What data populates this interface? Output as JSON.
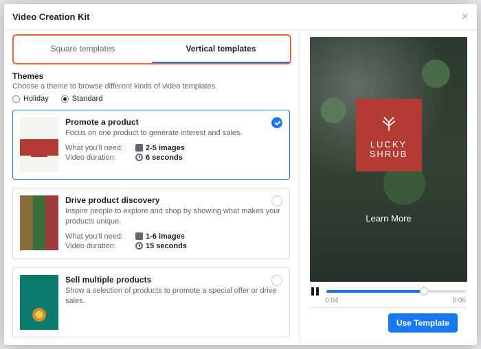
{
  "modal": {
    "title": "Video Creation Kit"
  },
  "tabs": {
    "square": "Square templates",
    "vertical": "Vertical templates"
  },
  "themes": {
    "heading": "Themes",
    "description": "Choose a theme to browse different kinds of video templates.",
    "options": {
      "holiday": "Holiday",
      "standard": "Standard"
    }
  },
  "needLabel": "What you'll need:",
  "durationLabel": "Video duration:",
  "cards": [
    {
      "title": "Promote a product",
      "desc": "Focus on one product to generate interest and sales.",
      "need": "2-5 images",
      "duration": "6 seconds"
    },
    {
      "title": "Drive product discovery",
      "desc": "Inspire people to explore and shop by showing what makes your products unique.",
      "need": "1-6 images",
      "duration": "15 seconds"
    },
    {
      "title": "Sell multiple products",
      "desc": "Show a selection of products to promote a special offer or drive sales.",
      "need": "",
      "duration": ""
    }
  ],
  "preview": {
    "brandLine1": "LUCKY",
    "brandLine2": "SHRUB",
    "cta": "Learn More"
  },
  "player": {
    "current": "0:04",
    "total": "0:06"
  },
  "footer": {
    "useTemplate": "Use Template"
  }
}
